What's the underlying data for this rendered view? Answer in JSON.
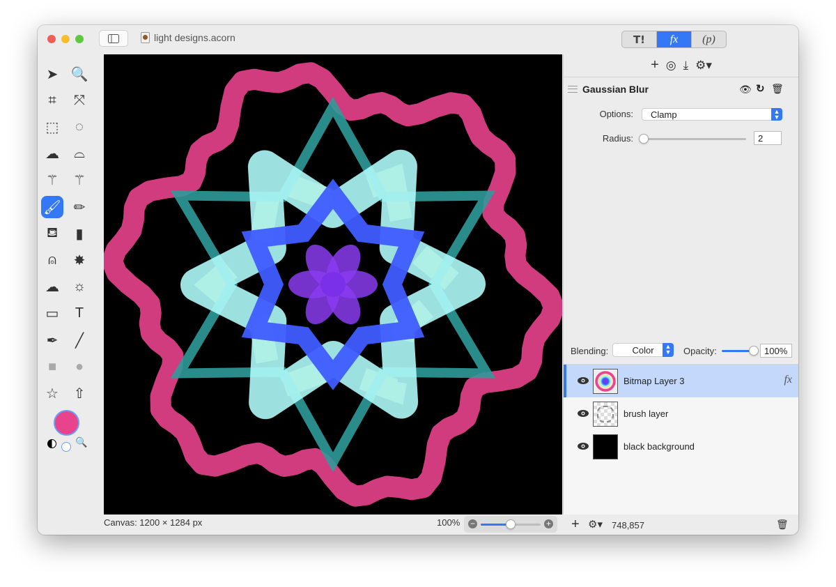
{
  "window": {
    "title": "light designs.acorn",
    "traffic_lights": {
      "close": "#ee5f58",
      "minimize": "#f9be2f",
      "zoom": "#5ec840"
    }
  },
  "mode_tabs": [
    {
      "icon": "tools-icon",
      "label": "T!",
      "selected": false
    },
    {
      "icon": "fx-icon",
      "label": "fx",
      "selected": true
    },
    {
      "icon": "p-icon",
      "label": "(p)",
      "selected": false
    }
  ],
  "filter_toolbar": [
    "add-icon",
    "mask-icon",
    "download-icon",
    "gear-icon"
  ],
  "filter": {
    "name": "Gaussian Blur",
    "options_label": "Options:",
    "options_value": "Clamp",
    "radius_label": "Radius:",
    "radius_value": "2",
    "radius_fraction": 0.02
  },
  "layer_controls": {
    "blending_label": "Blending:",
    "blending_value": "Color",
    "opacity_label": "Opacity:",
    "opacity_value": "100%",
    "opacity_fraction": 1.0
  },
  "layers": [
    {
      "name": "Bitmap Layer 3",
      "selected": true,
      "fx": "fx",
      "visible": true
    },
    {
      "name": "brush layer",
      "selected": false,
      "visible": true
    },
    {
      "name": "black background",
      "selected": false,
      "visible": true
    }
  ],
  "status": {
    "canvas": "Canvas: 1200 × 1284 px",
    "zoom": "100%",
    "zoom_fraction": 0.5,
    "coords": "748,857"
  },
  "tools": [
    "select",
    "zoom",
    "crop",
    "transform",
    "rect-select",
    "ellipse-select",
    "lasso",
    "polygon-lasso",
    "magic-wand",
    "instant-alpha",
    "brush",
    "pencil",
    "paint-bucket",
    "eraser",
    "clone-stamp",
    "smudge",
    "cloud",
    "sun",
    "gradient",
    "text",
    "pen",
    "line",
    "rectangle",
    "ellipse",
    "star",
    "arrow"
  ],
  "selected_tool": "brush",
  "colors": {
    "accent": "#3478f6",
    "foreground": "#e8438c",
    "selected_row": "#c3d8fb"
  }
}
